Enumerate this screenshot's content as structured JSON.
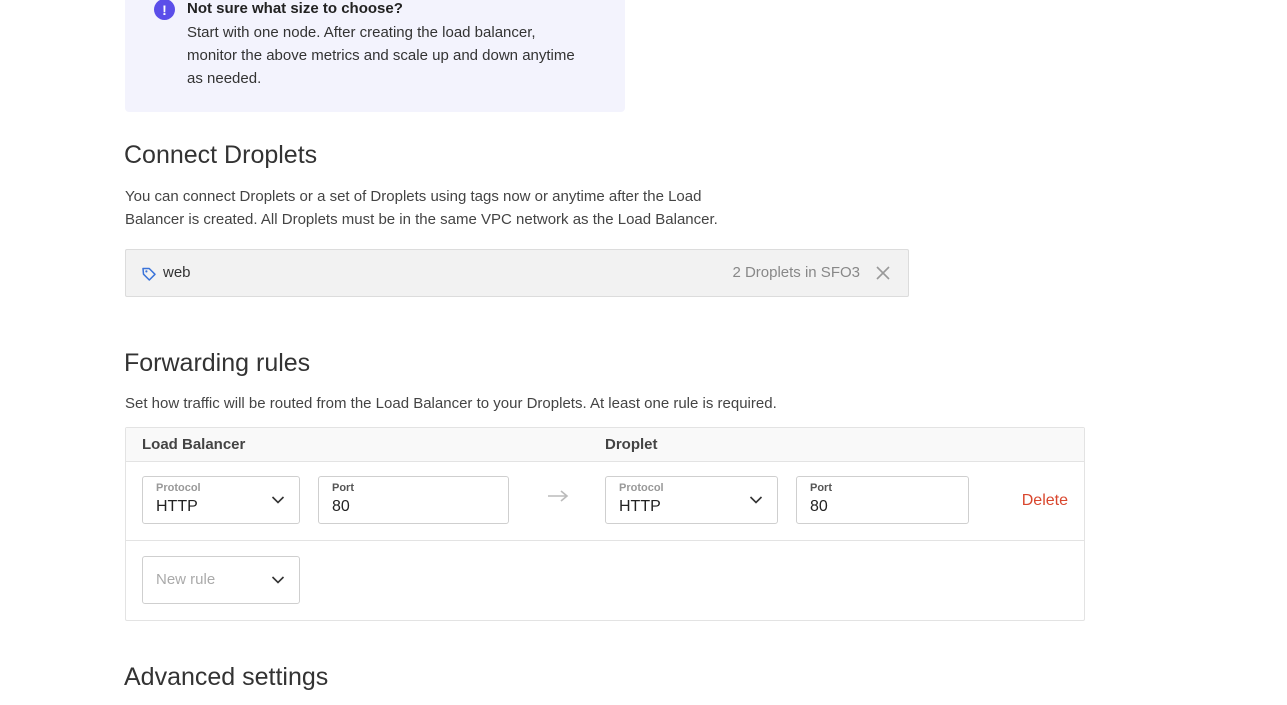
{
  "info": {
    "title": "Not sure what size to choose?",
    "body": "Start with one node. After creating the load balancer, monitor the above metrics and scale up and down anytime as needed.",
    "icon": "exclamation-icon"
  },
  "connect": {
    "heading": "Connect Droplets",
    "description": "You can connect Droplets or a set of Droplets using tags now or anytime after the Load Balancer is created. All Droplets must be in the same VPC network as the Load Balancer.",
    "tag": {
      "name": "web",
      "count": "2 Droplets in SFO3"
    }
  },
  "forwarding": {
    "heading": "Forwarding rules",
    "description": "Set how traffic will be routed from the Load Balancer to your Droplets. At least one rule is required.",
    "columns": {
      "load_balancer": "Load Balancer",
      "droplet": "Droplet"
    },
    "rule": {
      "lb_protocol_label": "Protocol",
      "lb_protocol": "HTTP",
      "lb_port_label": "Port",
      "lb_port": "80",
      "dr_protocol_label": "Protocol",
      "dr_protocol": "HTTP",
      "dr_port_label": "Port",
      "dr_port": "80",
      "delete": "Delete"
    },
    "new_rule": "New rule"
  },
  "advanced": {
    "heading": "Advanced settings"
  },
  "colors": {
    "accent": "#5b4ee9",
    "danger": "#d9462d",
    "info_bg": "#f3f3fd"
  }
}
